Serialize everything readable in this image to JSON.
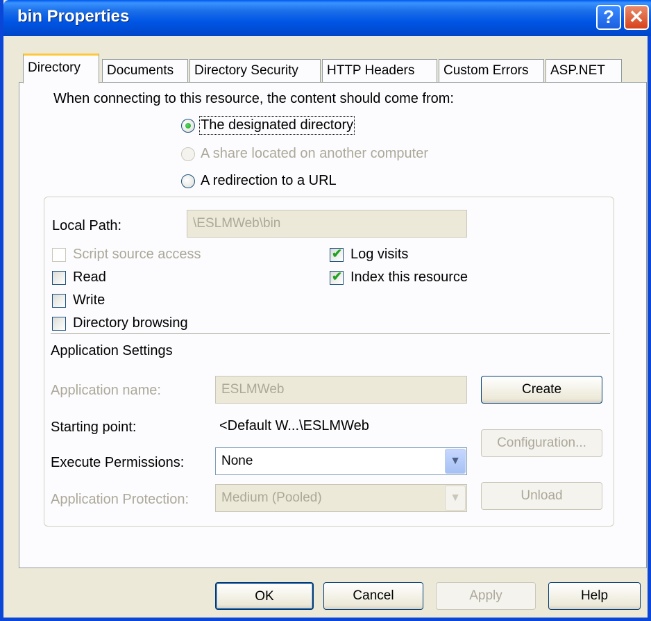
{
  "window": {
    "title": "bin Properties"
  },
  "tabs": [
    "Directory",
    "Documents",
    "Directory Security",
    "HTTP Headers",
    "Custom Errors",
    "ASP.NET"
  ],
  "directory": {
    "prompt": "When connecting to this resource, the content should come from:",
    "options": [
      {
        "label": "The designated directory",
        "selected": true,
        "enabled": true
      },
      {
        "label": "A share located on another computer",
        "selected": false,
        "enabled": false
      },
      {
        "label": "A redirection to a URL",
        "selected": false,
        "enabled": true
      }
    ],
    "local_path": {
      "label": "Local Path:",
      "value": "\\ESLMWeb\\bin"
    },
    "checkboxes": [
      {
        "label": "Script source access",
        "checked": false,
        "enabled": false
      },
      {
        "label": "Read",
        "checked": false,
        "enabled": true
      },
      {
        "label": "Write",
        "checked": false,
        "enabled": true
      },
      {
        "label": "Directory browsing",
        "checked": false,
        "enabled": true
      },
      {
        "label": "Log visits",
        "checked": true,
        "enabled": true
      },
      {
        "label": "Index this resource",
        "checked": true,
        "enabled": true
      }
    ],
    "app_settings": {
      "heading": "Application Settings",
      "name_label": "Application name:",
      "name_value": "ESLMWeb",
      "starting_label": "Starting point:",
      "starting_value": "<Default W...\\ESLMWeb",
      "exec_label": "Execute Permissions:",
      "exec_value": "None",
      "protection_label": "Application Protection:",
      "protection_value": "Medium (Pooled)",
      "create_button": "Create",
      "configuration_button": "Configuration...",
      "unload_button": "Unload"
    }
  },
  "footer": {
    "ok": "OK",
    "cancel": "Cancel",
    "apply": "Apply",
    "help": "Help"
  }
}
